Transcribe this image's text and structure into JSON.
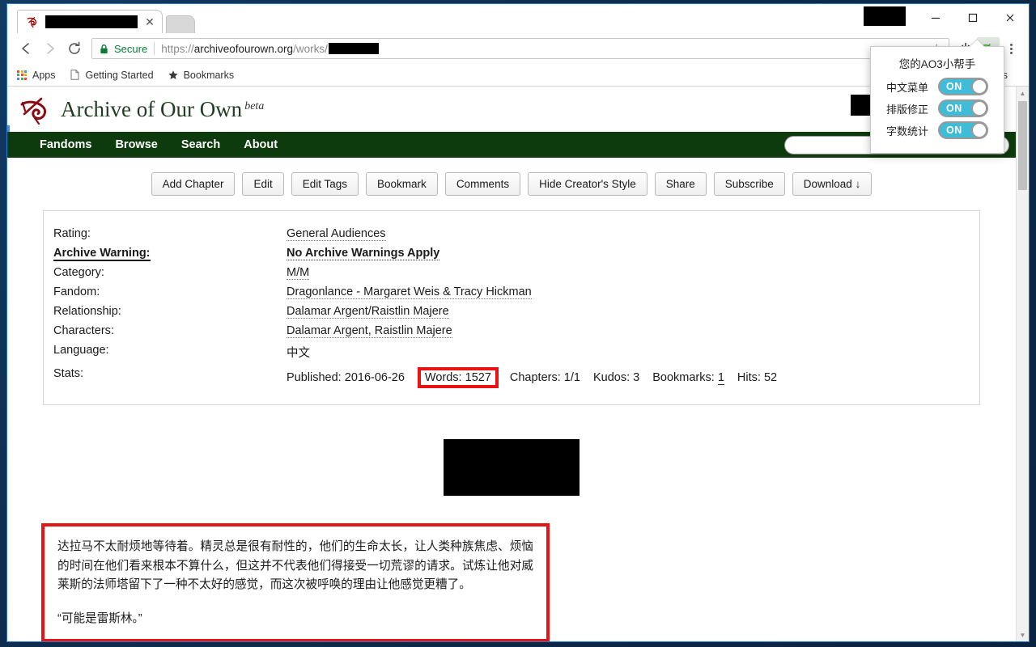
{
  "browser": {
    "tab": {
      "favicon": "ao3-favicon",
      "title_redacted": true
    },
    "new_tab_label": "",
    "window_controls": {
      "minimize": "minimize-icon",
      "maximize": "maximize-icon",
      "close": "close-icon"
    },
    "nav": {
      "back": "back-arrow-icon",
      "forward": "forward-arrow-icon",
      "reload": "reload-icon"
    },
    "omnibox": {
      "security_label": "Secure",
      "url_scheme": "https://",
      "url_host": "archiveofourown.org",
      "url_path": "/works/",
      "url_redacted": true,
      "bookmark_star": "star-icon"
    },
    "toolbar_icons": [
      "power-icon",
      "ao3-extension-icon",
      "chrome-menu-icon"
    ],
    "bookmarks": [
      {
        "label": "Apps",
        "icon": "apps-grid-icon"
      },
      {
        "label": "Getting Started",
        "icon": "page-icon"
      },
      {
        "label": "Bookmarks",
        "icon": "star-icon"
      },
      {
        "label": "arks",
        "icon": "none"
      }
    ]
  },
  "popup": {
    "title": "您的AO3小帮手",
    "toggles": [
      {
        "label": "中文菜单",
        "state": "ON"
      },
      {
        "label": "排版修正",
        "state": "ON"
      },
      {
        "label": "字数统计",
        "state": "ON"
      }
    ],
    "accent_color": "#3fbcd8"
  },
  "site": {
    "logo": "ao3-logo",
    "title": "Archive of Our Own",
    "beta": "beta",
    "nav": [
      "Fandoms",
      "Browse",
      "Search",
      "About"
    ],
    "nav_bg": "#0d3b0d",
    "search_placeholder": ""
  },
  "work_actions": [
    "Add Chapter",
    "Edit",
    "Edit Tags",
    "Bookmark",
    "Comments",
    "Hide Creator's Style",
    "Share",
    "Subscribe",
    "Download ↓"
  ],
  "meta": {
    "rows": [
      {
        "label": "Rating:",
        "value": "General Audiences",
        "bold": false,
        "link": true
      },
      {
        "label": "Archive Warning:",
        "value": "No Archive Warnings Apply",
        "bold": true,
        "link": true
      },
      {
        "label": "Category:",
        "value": "M/M",
        "bold": false,
        "link": true
      },
      {
        "label": "Fandom:",
        "value": "Dragonlance - Margaret Weis & Tracy Hickman",
        "bold": false,
        "link": true
      },
      {
        "label": "Relationship:",
        "value": "Dalamar Argent/Raistlin Majere",
        "bold": false,
        "link": true
      },
      {
        "label": "Characters:",
        "value": "Dalamar Argent,  Raistlin Majere",
        "bold": false,
        "link": true
      },
      {
        "label": "Language:",
        "value": "中文",
        "bold": false,
        "link": false
      }
    ],
    "stats_label": "Stats:",
    "stats": {
      "published_label": "Published:",
      "published_value": "2016-06-26",
      "words_label": "Words:",
      "words_value": "1527",
      "chapters_label": "Chapters:",
      "chapters_value": "1/1",
      "kudos_label": "Kudos:",
      "kudos_value": "3",
      "bookmarks_label": "Bookmarks:",
      "bookmarks_value": "1",
      "hits_label": "Hits:",
      "hits_value": "52"
    },
    "highlight_color": "#e81313"
  },
  "body": {
    "paragraph1": "达拉马不太耐烦地等待着。精灵总是很有耐性的，他们的生命太长，让人类种族焦虑、烦恼的时间在他们看来根本不算什么，但这并不代表他们得接受一切荒谬的请求。试炼让他对威莱斯的法师塔留下了一种不太好的感觉，而这次被呼唤的理由让他感觉更糟了。",
    "paragraph2": "“可能是雷斯林。”"
  }
}
